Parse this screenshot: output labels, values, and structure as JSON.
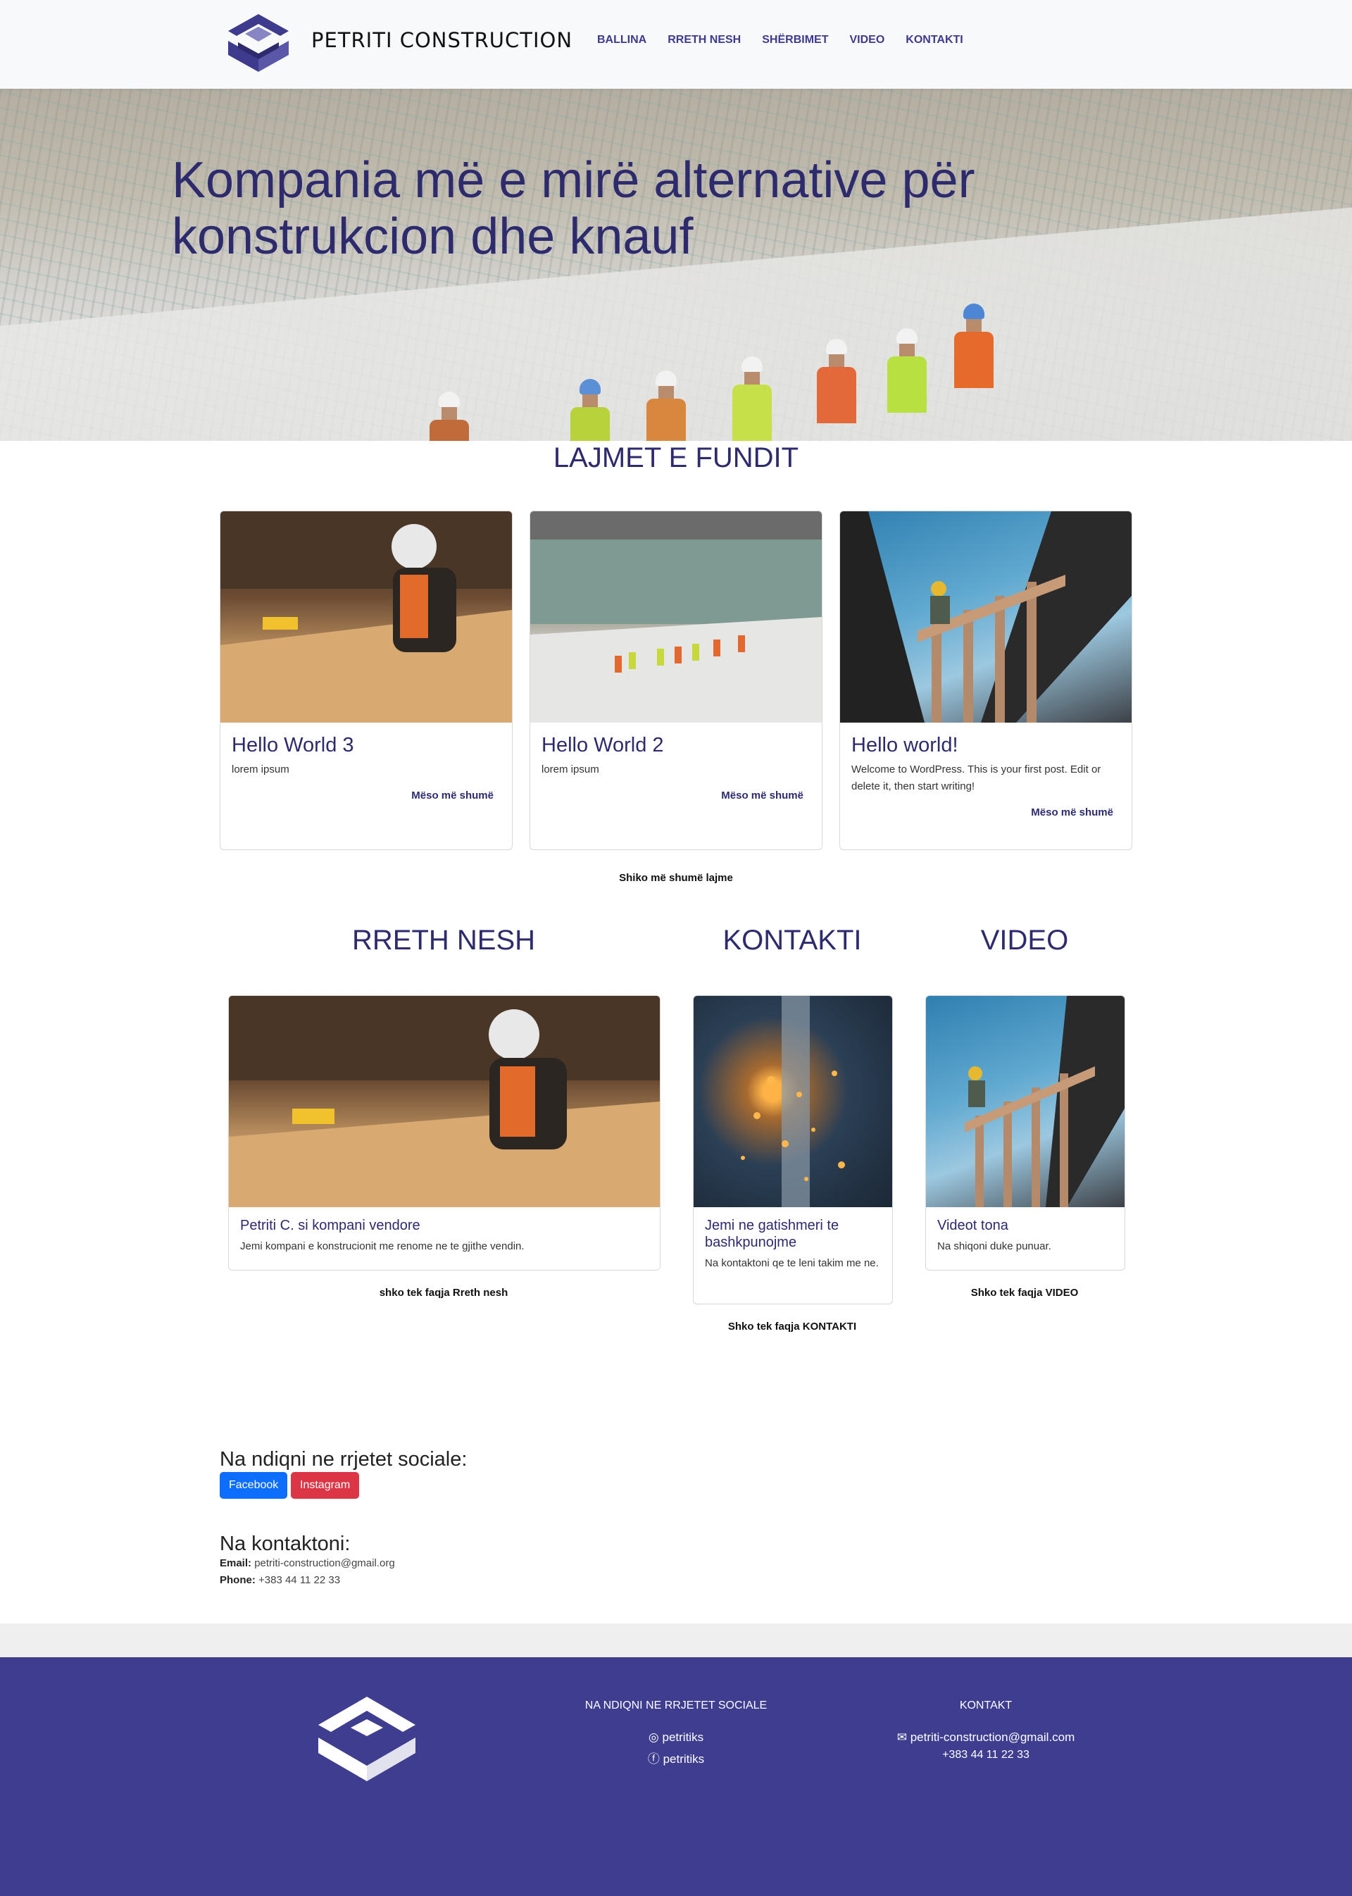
{
  "header": {
    "brand": "PETRITI CONSTRUCTION",
    "nav": [
      "BALLINA",
      "RRETH NESH",
      "SHËRBIMET",
      "VIDEO",
      "KONTAKTI"
    ]
  },
  "hero": {
    "title": "Kompania më e mirë alternative për konstrukcion dhe knauf"
  },
  "news": {
    "title": "LAJMET E FUNDIT",
    "cards": [
      {
        "title": "Hello World 3",
        "text": "lorem ipsum",
        "more": "Mëso më shumë"
      },
      {
        "title": "Hello World 2",
        "text": "lorem ipsum",
        "more": "Mëso më shumë"
      },
      {
        "title": "Hello world!",
        "text": "Welcome to WordPress. This is your first post. Edit or delete it, then start writing!",
        "more": "Mëso më shumë"
      }
    ],
    "see_more": "Shiko më shumë lajme"
  },
  "about": {
    "title": "RRETH NESH",
    "card_title": "Petriti C. si kompani vendore",
    "card_text": "Jemi kompani e konstrucionit me renome ne te gjithe vendin.",
    "link": "shko tek faqja Rreth nesh"
  },
  "contact_section": {
    "title": "KONTAKTI",
    "card_title": "Jemi ne gatishmeri te bashkpunojme",
    "card_text": "Na kontaktoni qe te leni takim me ne.",
    "link": "Shko tek faqja KONTAKTI"
  },
  "video_section": {
    "title": "VIDEO",
    "card_title": "Videot tona",
    "card_text": "Na shiqoni duke punuar.",
    "link": "Shko tek faqja VIDEO"
  },
  "social": {
    "heading": "Na ndiqni ne rrjetet sociale:",
    "facebook": "Facebook",
    "instagram": "Instagram",
    "facebook_color": "#0d6efd",
    "instagram_color": "#dc3545"
  },
  "contact_info": {
    "heading": "Na kontaktoni:",
    "email_label": "Email:",
    "email": "petriti-construction@gmail.org",
    "phone_label": "Phone:",
    "phone": "+383 44 11 22 33"
  },
  "footer": {
    "social_title": "NA NDIQNI NE RRJETET SOCIALE",
    "instagram_handle": "petritiks",
    "facebook_handle": "petritiks",
    "contact_title": "KONTAKT",
    "email": "petriti-construction@gmail.com",
    "phone": "+383 44 11 22 33",
    "bg_color": "#3e3d8f"
  }
}
